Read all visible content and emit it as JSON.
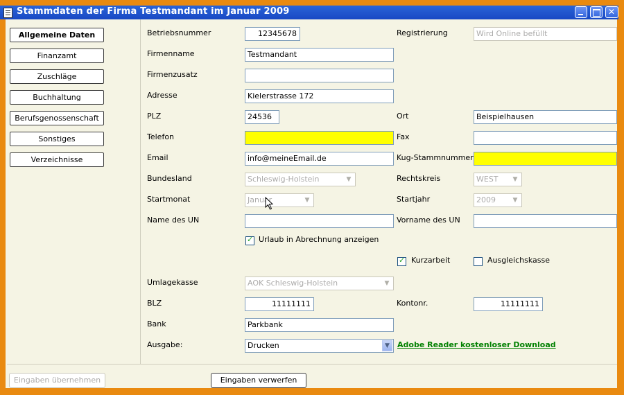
{
  "window": {
    "title": "Stammdaten der Firma Testmandant im Januar 2009"
  },
  "nav": {
    "items": [
      {
        "label": "Allgemeine Daten"
      },
      {
        "label": "Finanzamt"
      },
      {
        "label": "Zuschläge"
      },
      {
        "label": "Buchhaltung"
      },
      {
        "label": "Berufsgenossenschaft"
      },
      {
        "label": "Sonstiges"
      },
      {
        "label": "Verzeichnisse"
      }
    ]
  },
  "form": {
    "betriebsnummer": {
      "label": "Betriebsnummer",
      "value": "12345678"
    },
    "registrierung": {
      "label": "Registrierung",
      "value": "Wird Online befüllt"
    },
    "firmenname": {
      "label": "Firmenname",
      "value": "Testmandant"
    },
    "firmenzusatz": {
      "label": "Firmenzusatz",
      "value": ""
    },
    "adresse": {
      "label": "Adresse",
      "value": "Kielerstrasse 172"
    },
    "plz": {
      "label": "PLZ",
      "value": "24536"
    },
    "ort": {
      "label": "Ort",
      "value": "Beispielhausen"
    },
    "telefon": {
      "label": "Telefon",
      "value": ""
    },
    "fax": {
      "label": "Fax",
      "value": ""
    },
    "email": {
      "label": "Email",
      "value": "info@meineEmail.de"
    },
    "kug": {
      "label": "Kug-Stammnummer",
      "value": ""
    },
    "bundesland": {
      "label": "Bundesland",
      "value": "Schleswig-Holstein"
    },
    "rechtskreis": {
      "label": "Rechtskreis",
      "value": "WEST"
    },
    "startmonat": {
      "label": "Startmonat",
      "value": "Januar"
    },
    "startjahr": {
      "label": "Startjahr",
      "value": "2009"
    },
    "name_un": {
      "label": "Name des UN",
      "value": ""
    },
    "vorname_un": {
      "label": "Vorname des UN",
      "value": ""
    },
    "urlaub": {
      "label": "Urlaub in Abrechnung anzeigen",
      "checked": true
    },
    "kurzarbeit": {
      "label": "Kurzarbeit",
      "checked": true
    },
    "ausgleichskasse": {
      "label": "Ausgleichskasse",
      "checked": false
    },
    "umlagekasse": {
      "label": "Umlagekasse",
      "value": "AOK Schleswig-Holstein"
    },
    "blz": {
      "label": "BLZ",
      "value": "11111111"
    },
    "kontonr": {
      "label": "Kontonr.",
      "value": "11111111"
    },
    "bank": {
      "label": "Bank",
      "value": "Parkbank"
    },
    "ausgabe": {
      "label": "Ausgabe:",
      "value": "Drucken"
    },
    "download_link": "Adobe Reader kostenloser Download"
  },
  "footer": {
    "apply_label": "Eingaben übernehmen",
    "discard_label": "Eingaben verwerfen"
  },
  "colors": {
    "title_bar": "#2058d0",
    "frame": "#e98a10",
    "client_bg": "#f5f4e4",
    "required_field": "#ffff00",
    "link": "#008000"
  }
}
